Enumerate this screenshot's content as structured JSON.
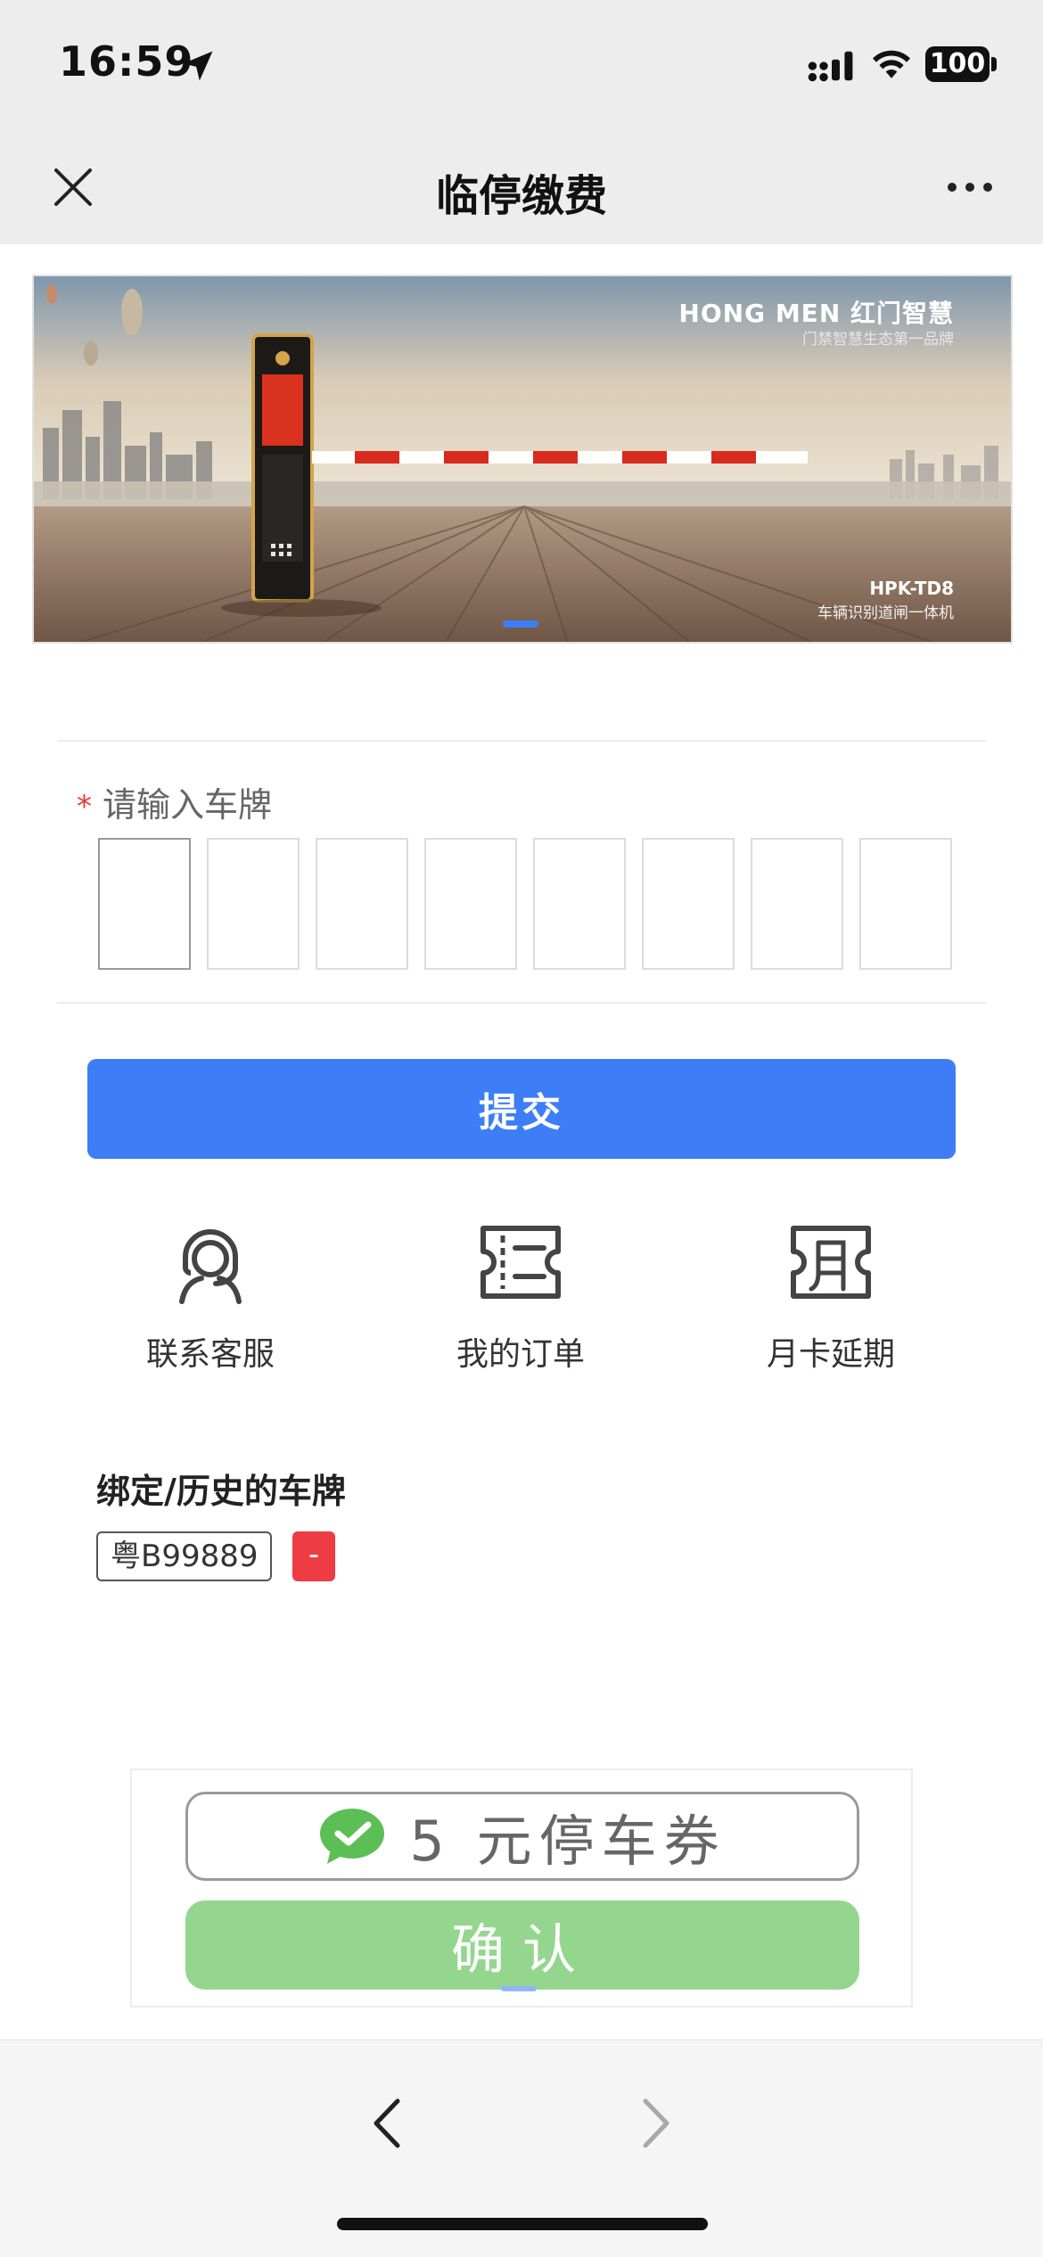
{
  "status_bar": {
    "time": "16:59",
    "battery": "100",
    "icons": [
      "location-arrow-icon",
      "signal-icon",
      "wifi-icon",
      "battery-icon"
    ]
  },
  "header": {
    "title": "临停缴费",
    "close_icon": "close-icon",
    "more_icon": "more-icon"
  },
  "banner": {
    "brand": "HONG MEN 红门智慧",
    "tagline": "门禁智慧生态第一品牌",
    "model": "HPK-TD8",
    "model_desc": "车辆识别道闸一体机"
  },
  "plate_input": {
    "required_mark": "*",
    "label": "请输入车牌",
    "box_count": 8
  },
  "submit_label": "提交",
  "shortcuts": [
    {
      "label": "联系客服",
      "icon": "customer-service-icon"
    },
    {
      "label": "我的订单",
      "icon": "ticket-icon"
    },
    {
      "label": "月卡延期",
      "icon": "month-card-icon"
    }
  ],
  "history": {
    "title": "绑定/历史的车牌",
    "plates": [
      "粤B99889"
    ],
    "remove_label": "-"
  },
  "coupon": {
    "text": "5 元停车券",
    "confirm_label": "确认",
    "icon": "wechat-check-icon"
  },
  "bottom_nav": {
    "back_icon": "chevron-left-icon",
    "forward_icon": "chevron-right-icon"
  },
  "colors": {
    "primary": "#3d7ef7",
    "danger": "#ef3b43",
    "confirm": "#95d68f",
    "wechat_green": "#5cbf55"
  }
}
